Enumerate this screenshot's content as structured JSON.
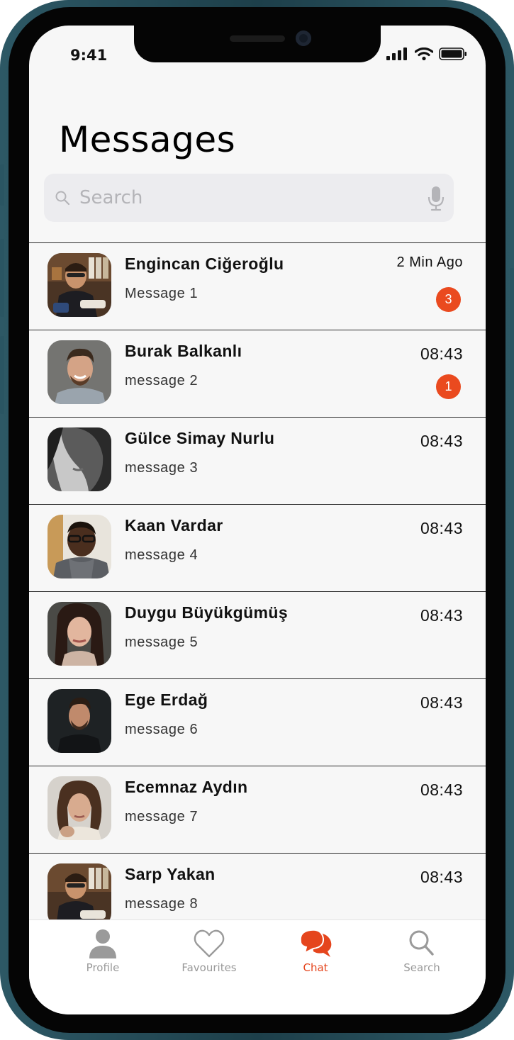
{
  "status_bar": {
    "time": "9:41"
  },
  "header": {
    "title": "Messages"
  },
  "search": {
    "placeholder": "Search"
  },
  "chats": [
    {
      "name": "Engincan Ciğeroğlu",
      "preview": "Message 1",
      "time": "2 Min Ago",
      "unread": "3"
    },
    {
      "name": "Burak Balkanlı",
      "preview": "message 2",
      "time": "08:43",
      "unread": "1"
    },
    {
      "name": "Gülce Simay Nurlu",
      "preview": "message 3",
      "time": "08:43",
      "unread": ""
    },
    {
      "name": "Kaan Vardar",
      "preview": "message 4",
      "time": "08:43",
      "unread": ""
    },
    {
      "name": "Duygu Büyükgümüş",
      "preview": "message 5",
      "time": "08:43",
      "unread": ""
    },
    {
      "name": "Ege Erdağ",
      "preview": "message 6",
      "time": "08:43",
      "unread": ""
    },
    {
      "name": "Ecemnaz Aydın",
      "preview": "message 7",
      "time": "08:43",
      "unread": ""
    },
    {
      "name": "Sarp Yakan",
      "preview": "message 8",
      "time": "08:43",
      "unread": ""
    }
  ],
  "tabs": [
    {
      "label": "Profile",
      "icon": "person-icon",
      "active": false
    },
    {
      "label": "Favourites",
      "icon": "heart-icon",
      "active": false
    },
    {
      "label": "Chat",
      "icon": "chat-bubbles-icon",
      "active": true
    },
    {
      "label": "Search",
      "icon": "search-icon",
      "active": false
    }
  ],
  "colors": {
    "accent": "#e5451d",
    "badge": "#ea4a1f",
    "background": "#f7f7f7",
    "frame": "#1d3f4a"
  }
}
